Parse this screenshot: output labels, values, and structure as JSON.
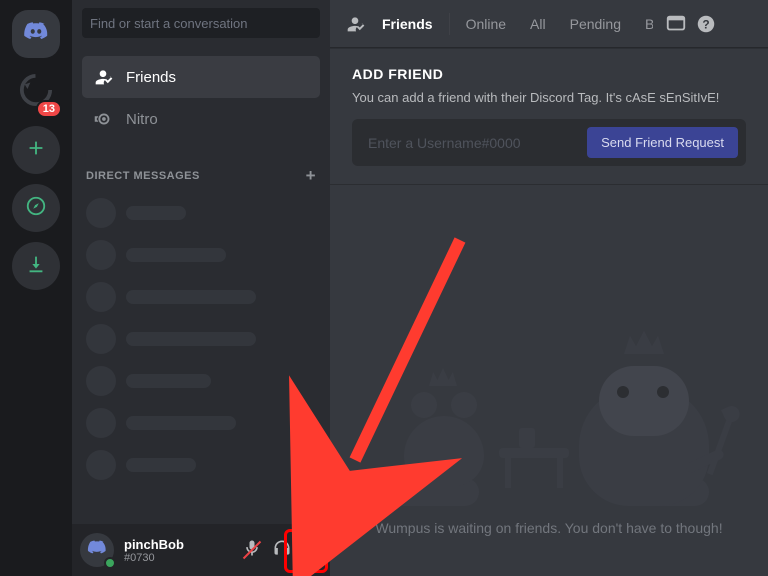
{
  "server_rail": {
    "update_badge": "13"
  },
  "channels": {
    "search_placeholder": "Find or start a conversation",
    "items": [
      {
        "label": "Friends"
      },
      {
        "label": "Nitro"
      }
    ],
    "dm_header": "DIRECT MESSAGES"
  },
  "user": {
    "name": "pinchBob",
    "tag": "#0730"
  },
  "top_bar": {
    "tabs": [
      {
        "label": "Friends"
      },
      {
        "label": "Online"
      },
      {
        "label": "All"
      },
      {
        "label": "Pending"
      },
      {
        "label": "B"
      }
    ]
  },
  "add_friend": {
    "heading": "ADD FRIEND",
    "subtext": "You can add a friend with their Discord Tag. It's cAsE sEnSitIvE!",
    "placeholder": "Enter a Username#0000",
    "button": "Send Friend Request"
  },
  "empty": {
    "caption": "Wumpus is waiting on friends. You don't have to though!"
  },
  "annotation": {
    "arrow_target": "settings-button"
  },
  "colors": {
    "accent": "#7289da",
    "annotation": "#ff3b2f"
  }
}
